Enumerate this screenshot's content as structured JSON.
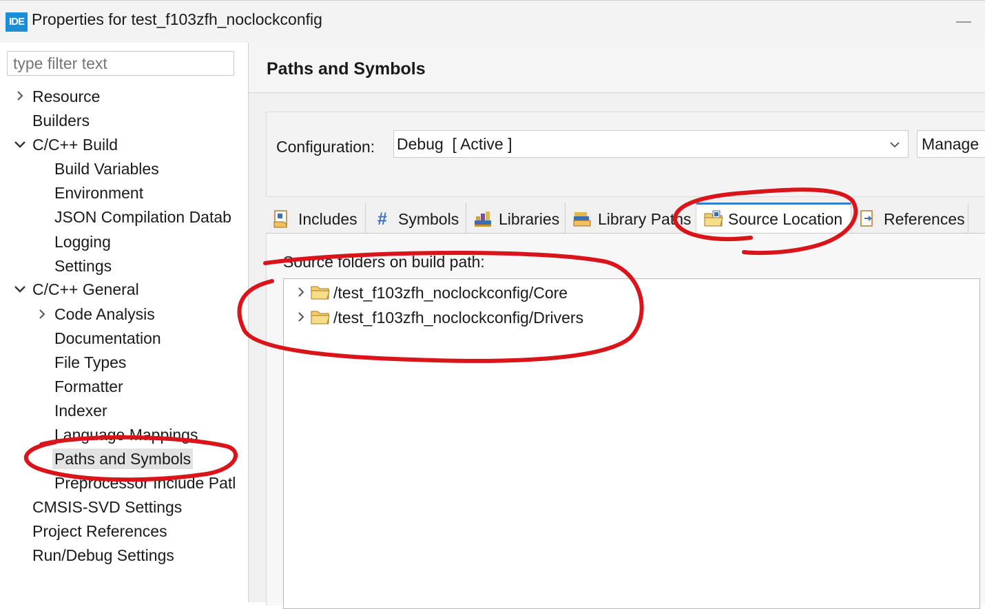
{
  "window": {
    "app_icon_text": "IDE",
    "title": "Properties for test_f103zfh_noclockconfig"
  },
  "sidebar": {
    "filter_placeholder": "type filter text",
    "items": [
      {
        "label": "Resource",
        "twisty": "collapsed"
      },
      {
        "label": "Builders"
      },
      {
        "label": "C/C++ Build",
        "twisty": "expanded"
      },
      {
        "label": "Build Variables"
      },
      {
        "label": "Environment"
      },
      {
        "label": "JSON Compilation Datab"
      },
      {
        "label": "Logging"
      },
      {
        "label": "Settings"
      },
      {
        "label": "C/C++ General",
        "twisty": "expanded"
      },
      {
        "label": "Code Analysis",
        "twisty": "collapsed"
      },
      {
        "label": "Documentation"
      },
      {
        "label": "File Types"
      },
      {
        "label": "Formatter"
      },
      {
        "label": "Indexer"
      },
      {
        "label": "Language Mappings"
      },
      {
        "label": "Paths and Symbols",
        "selected": true
      },
      {
        "label": "Preprocessor Include Patl"
      },
      {
        "label": "CMSIS-SVD Settings"
      },
      {
        "label": "Project References"
      },
      {
        "label": "Run/Debug Settings"
      }
    ]
  },
  "main": {
    "title": "Paths and Symbols",
    "configuration_label": "Configuration:",
    "configuration_value": "Debug  [ Active ]",
    "manage_label": "Manage",
    "tabs": [
      {
        "label": "Includes",
        "icon": "includes-icon"
      },
      {
        "label": "Symbols",
        "icon": "hash-icon"
      },
      {
        "label": "Libraries",
        "icon": "libraries-icon"
      },
      {
        "label": "Library Paths",
        "icon": "library-paths-icon"
      },
      {
        "label": "Source Location",
        "icon": "source-folder-icon",
        "active": true
      },
      {
        "label": "References",
        "icon": "references-icon"
      }
    ],
    "source_label": "Source folders on build path:",
    "source_folders": [
      "/test_f103zfh_noclockconfig/Core",
      "/test_f103zfh_noclockconfig/Drivers"
    ]
  },
  "colors": {
    "accent": "#2f7fd0",
    "annotation": "#d9141a",
    "selection": "#e2e2e2"
  }
}
